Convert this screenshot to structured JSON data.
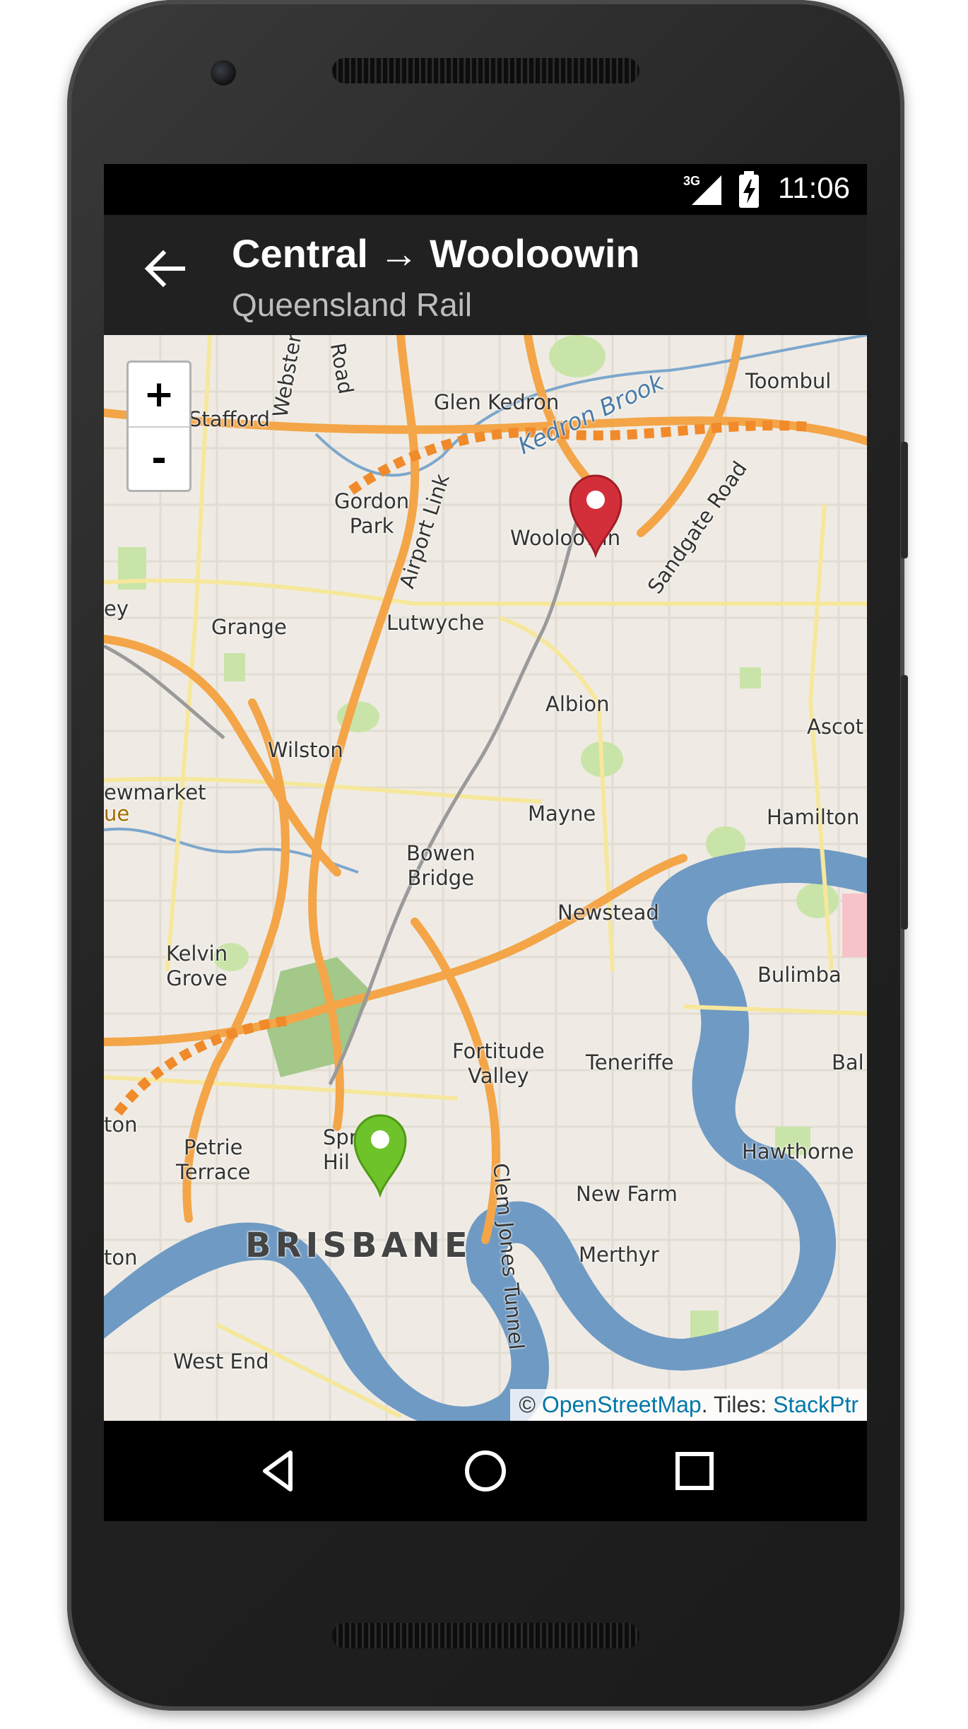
{
  "status_bar": {
    "network": "3G",
    "time": "11:06"
  },
  "app_bar": {
    "title": "Central → Wooloowin",
    "subtitle": "Queensland Rail"
  },
  "map": {
    "zoom_in_label": "+",
    "zoom_out_label": "-",
    "labels": {
      "toombul": "Toombul",
      "glen_kedron": "Glen Kedron",
      "kedron_brook": "Kedron Brook",
      "stafford": "Stafford",
      "webster": "Webster",
      "gordon_park": "Gordon\nPark",
      "airport_link": "Airport Link",
      "wooloowin": "Wooloowin",
      "sandgate_road": "Sandgate Road",
      "grange": "Grange",
      "lutwyche": "Lutwyche",
      "albion": "Albion",
      "ascot": "Ascot",
      "wilston": "Wilston",
      "newmarket": "ewmarket",
      "mayne": "Mayne",
      "hamilton": "Hamilton",
      "bowen_bridge": "Bowen\nBridge",
      "newstead": "Newstead",
      "kelvin_grove": "Kelvin\nGrove",
      "bulimba": "Bulimba",
      "fortitude_valley": "Fortitude\nValley",
      "teneriffe": "Teneriffe",
      "petrie_terrace": "Petrie\nTerrace",
      "spring_hill": "Spr\nHil",
      "hawthorne": "Hawthorne",
      "new_farm": "New Farm",
      "brisbane": "BRISBANE",
      "clem_jones_tunnel": "Clem Jones Tunnel",
      "merthyr": "Merthyr",
      "west_end": "West End",
      "milton": "ton",
      "balmoral": "Bal",
      "toowong": "ton",
      "road": "Road",
      "ey": "ey",
      "ue": "ue"
    },
    "markers": {
      "origin": "Central",
      "destination": "Wooloowin"
    },
    "attribution": {
      "prefix": "© ",
      "osm": "OpenStreetMap",
      "middle": ". Tiles: ",
      "tiles": "StackPtr"
    }
  },
  "colors": {
    "app_bar": "#212121",
    "water": "#6f9ac4",
    "motorway": "#f3a548",
    "park": "#c9e4a8",
    "marker_dest": "#d32f3b",
    "marker_origin": "#6fc32a"
  }
}
